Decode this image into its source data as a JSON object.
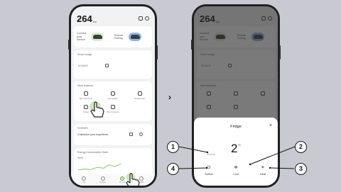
{
  "left_phone": {
    "range_value": "264",
    "range_unit": "km",
    "banner": {
      "left_text": "Connect your Service",
      "right_text": "Remote Parking"
    },
    "smart_image": {
      "title": "Smart image",
      "subtitle": "BOUNDS"
    },
    "more_features": {
      "title": "More features",
      "items": [
        "Set Functions",
        "Air Quality",
        "Suspension",
        "Fridge",
        "Tire Pressure"
      ]
    },
    "scenario": {
      "title": "SCENES",
      "subtitle": "Customize your experience"
    },
    "energy": {
      "title": "Energy Consumption Stats",
      "subtitle": "Week"
    },
    "nav": [
      "Car",
      "Explore",
      "My Car",
      "Profile"
    ]
  },
  "right_phone": {
    "range_value": "264",
    "range_unit": "km",
    "banner": {
      "left_text": "Connect your Service",
      "right_text": "Remote Parking"
    },
    "smart_image": {
      "title": "Smart image",
      "subtitle": "BOUNDS"
    },
    "more_features": {
      "title": "More features"
    },
    "sheet": {
      "title": "Fridge",
      "close": "×",
      "temperature_value": "2",
      "temperature_unit": "°C",
      "actions": [
        {
          "label": "Switch",
          "icon": "power-icon",
          "glyph": "⏻"
        },
        {
          "label": "Cool",
          "icon": "snowflake-icon",
          "glyph": "❄"
        },
        {
          "label": "Heat",
          "icon": "sun-icon",
          "glyph": "☀"
        }
      ]
    }
  },
  "arrow": "›",
  "callouts": [
    "1",
    "2",
    "3",
    "4"
  ],
  "colors": {
    "background": "#c9cad1",
    "phone_frame": "#202124",
    "green_chip": "#d9efc9",
    "blue_chip": "#8fb4e3",
    "touch_highlight": "#c8e6a8"
  }
}
